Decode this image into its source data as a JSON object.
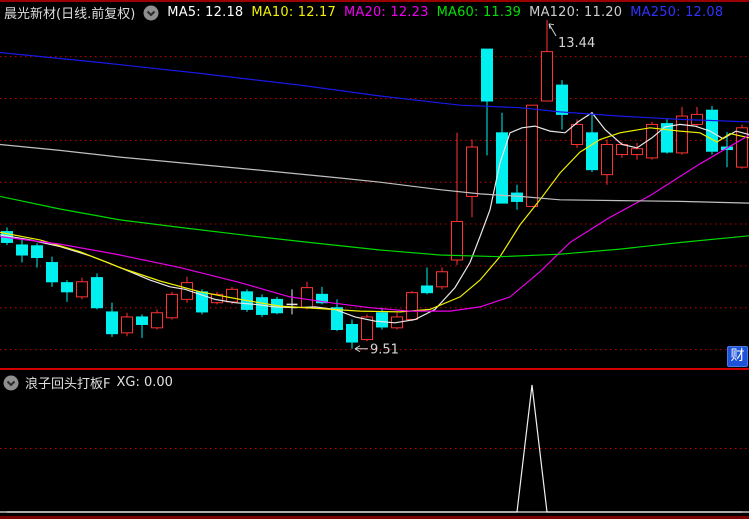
{
  "header": {
    "title": "晨光新材(日线.前复权)",
    "ma_items": [
      {
        "label": "MA5: 12.18",
        "color": "#ffffff"
      },
      {
        "label": "MA10: 12.17",
        "color": "#f0f000"
      },
      {
        "label": "MA20: 12.23",
        "color": "#f000f0"
      },
      {
        "label": "MA60: 11.39",
        "color": "#00e000"
      },
      {
        "label": "MA120: 11.20",
        "color": "#cccccc"
      },
      {
        "label": "MA250: 12.08",
        "color": "#3232ff"
      }
    ]
  },
  "sub_header": {
    "name": "浪子回头打板F",
    "value": "XG: 0.00"
  },
  "watermark": {
    "text": "财"
  },
  "colors": {
    "up_candle": "#ff3232",
    "down_candle": "#00f0f0",
    "doji_candle": "#e8e8e8",
    "grid": "#c40000",
    "annotation_text": "#d4d4d4",
    "sub_signal": "#f0f0f0",
    "sub_baseline": "#e8e8e8"
  },
  "chart_data": [
    {
      "type": "candlestick",
      "title": "晨光新材 日线 前复权 candlestick panel",
      "ylim": [
        9.28,
        13.39
      ],
      "grid": true,
      "gridline_prices": [
        9.5,
        10.0,
        10.5,
        11.0,
        11.5,
        12.0,
        12.5,
        13.0
      ],
      "annotations": [
        {
          "text": "13.44",
          "bar": 36,
          "price": 13.44,
          "kind": "high"
        },
        {
          "text": "9.51",
          "bar": 23,
          "price": 9.51,
          "kind": "low"
        }
      ],
      "candles_ohlc": [
        [
          10.91,
          10.96,
          10.75,
          10.78
        ],
        [
          10.75,
          10.81,
          10.54,
          10.63
        ],
        [
          10.74,
          10.77,
          10.48,
          10.6
        ],
        [
          10.54,
          10.61,
          10.25,
          10.31
        ],
        [
          10.3,
          10.33,
          10.07,
          10.19
        ],
        [
          10.13,
          10.36,
          10.1,
          10.31
        ],
        [
          10.36,
          10.41,
          9.98,
          10.0
        ],
        [
          9.95,
          10.06,
          9.65,
          9.69
        ],
        [
          9.7,
          9.94,
          9.66,
          9.89
        ],
        [
          9.89,
          9.92,
          9.64,
          9.8
        ],
        [
          9.76,
          9.98,
          9.74,
          9.94
        ],
        [
          9.88,
          10.19,
          9.86,
          10.16
        ],
        [
          10.1,
          10.37,
          10.06,
          10.3
        ],
        [
          10.19,
          10.22,
          9.92,
          9.95
        ],
        [
          10.06,
          10.19,
          10.04,
          10.16
        ],
        [
          10.07,
          10.25,
          10.04,
          10.22
        ],
        [
          10.19,
          10.22,
          9.95,
          9.98
        ],
        [
          10.12,
          10.16,
          9.89,
          9.92
        ],
        [
          10.1,
          10.13,
          9.92,
          9.94
        ],
        [
          10.04,
          10.22,
          9.92,
          10.04
        ],
        [
          10.0,
          10.31,
          9.98,
          10.24
        ],
        [
          10.16,
          10.25,
          10.04,
          10.06
        ],
        [
          10.0,
          10.1,
          9.72,
          9.74
        ],
        [
          9.8,
          9.86,
          9.51,
          9.59
        ],
        [
          9.62,
          9.92,
          9.6,
          9.89
        ],
        [
          9.94,
          10.0,
          9.74,
          9.77
        ],
        [
          9.76,
          9.94,
          9.74,
          9.89
        ],
        [
          9.86,
          10.2,
          9.84,
          10.18
        ],
        [
          10.26,
          10.48,
          10.16,
          10.18
        ],
        [
          10.25,
          10.48,
          10.22,
          10.43
        ],
        [
          10.57,
          12.09,
          10.51,
          11.03
        ],
        [
          11.33,
          12.01,
          11.08,
          11.92
        ],
        [
          13.09,
          13.09,
          11.82,
          12.47
        ],
        [
          12.09,
          12.33,
          11.25,
          11.25
        ],
        [
          11.37,
          11.47,
          11.17,
          11.27
        ],
        [
          11.21,
          12.42,
          11.21,
          12.42
        ],
        [
          12.47,
          13.44,
          12.47,
          13.06
        ],
        [
          12.66,
          12.72,
          12.13,
          12.31
        ],
        [
          11.95,
          12.25,
          11.91,
          12.19
        ],
        [
          12.09,
          12.33,
          11.62,
          11.65
        ],
        [
          11.59,
          12.01,
          11.47,
          11.95
        ],
        [
          11.83,
          11.98,
          11.79,
          11.95
        ],
        [
          11.83,
          11.97,
          11.77,
          11.9
        ],
        [
          11.79,
          12.22,
          11.77,
          12.19
        ],
        [
          12.2,
          12.25,
          11.84,
          11.86
        ],
        [
          11.85,
          12.4,
          11.83,
          12.29
        ],
        [
          12.19,
          12.4,
          12.16,
          12.31
        ],
        [
          12.36,
          12.41,
          11.83,
          11.87
        ],
        [
          11.92,
          12.1,
          11.68,
          11.89
        ],
        [
          11.68,
          12.19,
          11.66,
          12.15
        ]
      ],
      "ma_series": [
        {
          "name": "MA5",
          "color": "#e8e8e8",
          "points": [
            [
              0,
              10.87
            ],
            [
              30,
              10.81
            ],
            [
              60,
              10.73
            ],
            [
              90,
              10.62
            ],
            [
              110,
              10.53
            ],
            [
              130,
              10.43
            ],
            [
              150,
              10.33
            ],
            [
              170,
              10.25
            ],
            [
              185,
              10.22
            ],
            [
              200,
              10.16
            ],
            [
              215,
              10.1
            ],
            [
              235,
              10.06
            ],
            [
              255,
              10.04
            ],
            [
              275,
              10.01
            ],
            [
              295,
              10.0
            ],
            [
              315,
              10.01
            ],
            [
              335,
              9.98
            ],
            [
              355,
              9.89
            ],
            [
              375,
              9.84
            ],
            [
              395,
              9.82
            ],
            [
              415,
              9.86
            ],
            [
              435,
              9.98
            ],
            [
              455,
              10.24
            ],
            [
              470,
              10.54
            ],
            [
              480,
              10.85
            ],
            [
              490,
              11.17
            ],
            [
              500,
              11.73
            ],
            [
              510,
              12.09
            ],
            [
              522,
              12.15
            ],
            [
              535,
              12.17
            ],
            [
              550,
              12.11
            ],
            [
              565,
              12.09
            ],
            [
              578,
              12.22
            ],
            [
              592,
              12.33
            ],
            [
              605,
              12.13
            ],
            [
              622,
              11.95
            ],
            [
              637,
              11.91
            ],
            [
              652,
              12.03
            ],
            [
              665,
              12.16
            ],
            [
              680,
              12.19
            ],
            [
              695,
              12.17
            ],
            [
              710,
              12.11
            ],
            [
              723,
              12.02
            ],
            [
              736,
              12.11
            ],
            [
              749,
              12.07
            ]
          ]
        },
        {
          "name": "MA10",
          "color": "#f0f000",
          "points": [
            [
              0,
              10.9
            ],
            [
              40,
              10.81
            ],
            [
              80,
              10.67
            ],
            [
              120,
              10.48
            ],
            [
              160,
              10.32
            ],
            [
              200,
              10.19
            ],
            [
              240,
              10.1
            ],
            [
              280,
              10.02
            ],
            [
              320,
              9.99
            ],
            [
              360,
              9.96
            ],
            [
              400,
              9.95
            ],
            [
              430,
              9.98
            ],
            [
              460,
              10.13
            ],
            [
              480,
              10.33
            ],
            [
              500,
              10.61
            ],
            [
              520,
              10.99
            ],
            [
              540,
              11.29
            ],
            [
              560,
              11.61
            ],
            [
              580,
              11.86
            ],
            [
              600,
              12.01
            ],
            [
              620,
              12.09
            ],
            [
              650,
              12.15
            ],
            [
              680,
              12.11
            ],
            [
              700,
              12.09
            ],
            [
              717,
              11.98
            ],
            [
              730,
              12.08
            ],
            [
              749,
              12.03
            ]
          ]
        },
        {
          "name": "MA20",
          "color": "#e800e8",
          "points": [
            [
              0,
              10.85
            ],
            [
              60,
              10.76
            ],
            [
              120,
              10.63
            ],
            [
              180,
              10.48
            ],
            [
              240,
              10.3
            ],
            [
              290,
              10.13
            ],
            [
              330,
              10.06
            ],
            [
              370,
              10.0
            ],
            [
              410,
              9.96
            ],
            [
              450,
              9.96
            ],
            [
              480,
              10.01
            ],
            [
              510,
              10.13
            ],
            [
              540,
              10.43
            ],
            [
              570,
              10.78
            ],
            [
              610,
              11.08
            ],
            [
              650,
              11.34
            ],
            [
              700,
              11.72
            ],
            [
              749,
              12.06
            ]
          ]
        },
        {
          "name": "MA60",
          "color": "#00d800",
          "points": [
            [
              0,
              11.33
            ],
            [
              60,
              11.18
            ],
            [
              120,
              11.05
            ],
            [
              180,
              10.96
            ],
            [
              250,
              10.86
            ],
            [
              310,
              10.78
            ],
            [
              380,
              10.69
            ],
            [
              440,
              10.63
            ],
            [
              500,
              10.61
            ],
            [
              560,
              10.64
            ],
            [
              620,
              10.7
            ],
            [
              680,
              10.78
            ],
            [
              749,
              10.86
            ]
          ]
        },
        {
          "name": "MA120",
          "color": "#c0c0c0",
          "points": [
            [
              0,
              11.95
            ],
            [
              60,
              11.88
            ],
            [
              120,
              11.8
            ],
            [
              200,
              11.71
            ],
            [
              280,
              11.62
            ],
            [
              340,
              11.55
            ],
            [
              380,
              11.5
            ],
            [
              440,
              11.41
            ],
            [
              480,
              11.36
            ],
            [
              520,
              11.33
            ],
            [
              560,
              11.29
            ],
            [
              620,
              11.28
            ],
            [
              680,
              11.27
            ],
            [
              749,
              11.25
            ]
          ]
        },
        {
          "name": "MA250",
          "color": "#1919e6",
          "points": [
            [
              0,
              13.05
            ],
            [
              100,
              12.93
            ],
            [
              200,
              12.8
            ],
            [
              300,
              12.66
            ],
            [
              380,
              12.53
            ],
            [
              460,
              12.42
            ],
            [
              520,
              12.39
            ],
            [
              560,
              12.34
            ],
            [
              620,
              12.29
            ],
            [
              680,
              12.25
            ],
            [
              749,
              12.22
            ]
          ]
        }
      ]
    },
    {
      "type": "line",
      "title": "浪子回头打板F indicator panel",
      "ylim": [
        0,
        1.15
      ],
      "gridline_values": [
        0.5
      ],
      "baseline_value": 0,
      "signal_bar": 35,
      "signal_value": 1.0,
      "values": [
        0,
        0,
        0,
        0,
        0,
        0,
        0,
        0,
        0,
        0,
        0,
        0,
        0,
        0,
        0,
        0,
        0,
        0,
        0,
        0,
        0,
        0,
        0,
        0,
        0,
        0,
        0,
        0,
        0,
        0,
        0,
        0,
        0,
        0,
        0,
        1,
        0,
        0,
        0,
        0,
        0,
        0,
        0,
        0,
        0,
        0,
        0,
        0,
        0,
        0
      ]
    }
  ]
}
